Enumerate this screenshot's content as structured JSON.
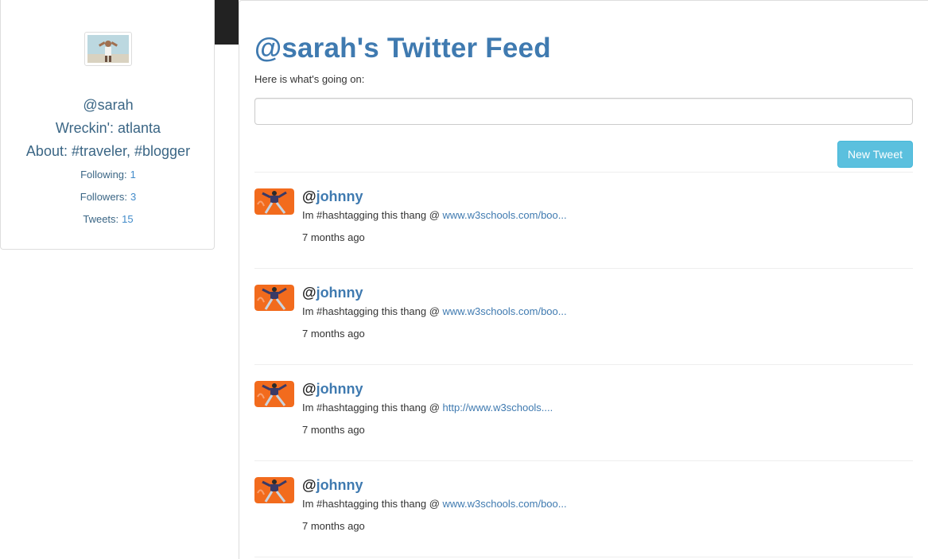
{
  "sidebar": {
    "handle": "@sarah",
    "location": "Wreckin': atlanta",
    "about": "About: #traveler, #blogger",
    "stats": [
      {
        "label": "Following:",
        "value": "1"
      },
      {
        "label": "Followers:",
        "value": "3"
      },
      {
        "label": "Tweets:",
        "value": "15"
      }
    ]
  },
  "main": {
    "title": "@sarah's Twitter Feed",
    "subtitle": "Here is what's going on:",
    "input_value": "",
    "new_tweet_label": "New Tweet"
  },
  "tweets": [
    {
      "at": "@",
      "user": "johnny",
      "text": "Im #hashtagging this thang @ ",
      "link": "www.w3schools.com/boo...",
      "time": "7 months ago"
    },
    {
      "at": "@",
      "user": "johnny",
      "text": "Im #hashtagging this thang @ ",
      "link": "www.w3schools.com/boo...",
      "time": "7 months ago"
    },
    {
      "at": "@",
      "user": "johnny",
      "text": "Im #hashtagging this thang @ ",
      "link": "http://www.w3schools....",
      "time": "7 months ago"
    },
    {
      "at": "@",
      "user": "johnny",
      "text": "Im #hashtagging this thang @ ",
      "link": "www.w3schools.com/boo...",
      "time": "7 months ago"
    }
  ],
  "colors": {
    "accent": "#3f7ab0",
    "button": "#5bc0de",
    "avatar_bg": "#f26b1d",
    "navbar": "#222222"
  }
}
